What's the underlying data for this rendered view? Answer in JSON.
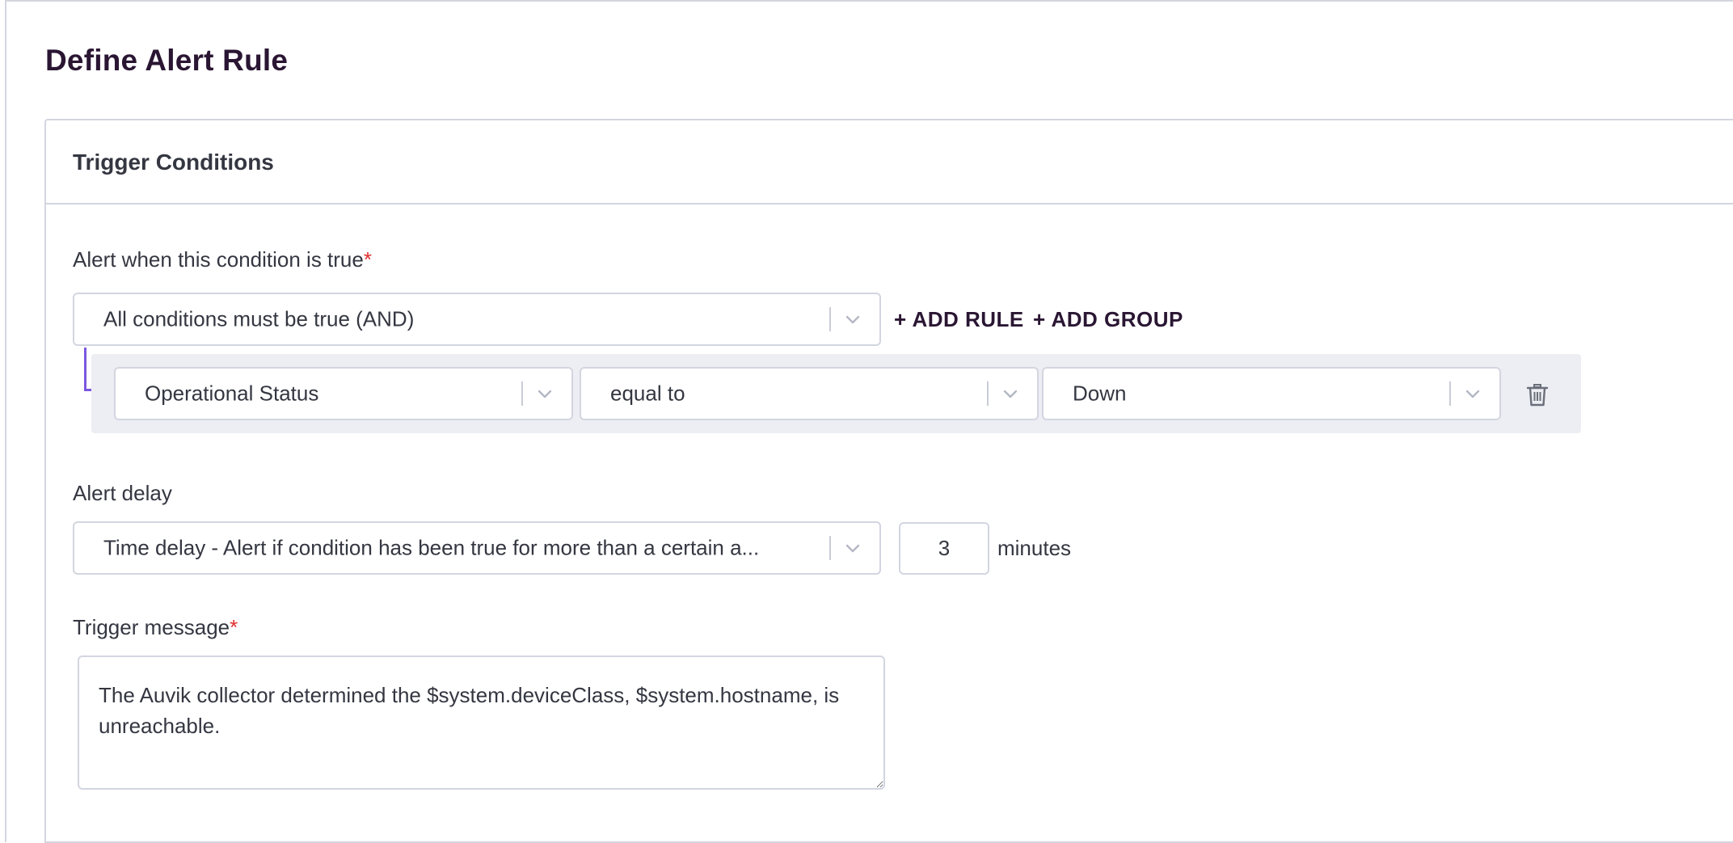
{
  "page": {
    "title": "Define Alert Rule"
  },
  "trigger_conditions": {
    "title": "Trigger Conditions",
    "condition_label": "Alert when this condition is true",
    "required_mark": "*",
    "combinator_select": {
      "value": "All conditions must be true (AND)"
    },
    "add_rule_label": "+ ADD RULE",
    "add_group_label": "+ ADD GROUP",
    "rule": {
      "field_value": "Operational Status",
      "operator_value": "equal to",
      "value_value": "Down"
    },
    "alert_delay": {
      "label": "Alert delay",
      "select_value": "Time delay - Alert if condition has been true for more than a certain a...",
      "minutes_value": "3",
      "minutes_label": "minutes"
    },
    "trigger_message": {
      "label": "Trigger message",
      "required_mark": "*",
      "value": "The Auvik collector determined the $system.deviceClass, $system.hostname, is unreachable."
    }
  },
  "icons": {
    "dropdown": "chevron-down-icon",
    "delete": "trash-icon"
  },
  "colors": {
    "title": "#2a1633",
    "required": "#e02d2d",
    "bracket": "#7b57e0",
    "rule_row_bg": "#edeef3",
    "border": "#d3d6e0"
  }
}
